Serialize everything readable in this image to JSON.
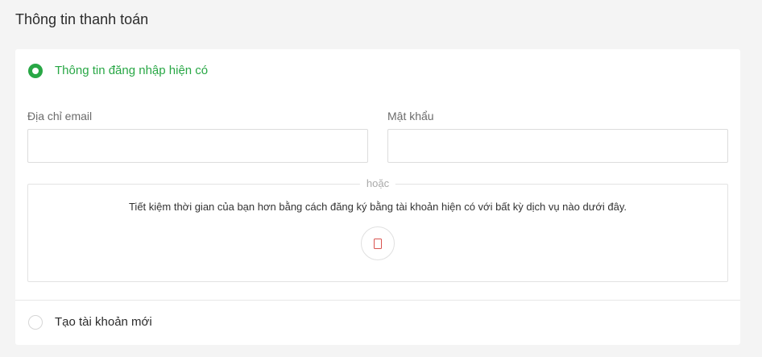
{
  "page": {
    "title": "Thông tin thanh toán"
  },
  "existing_login": {
    "label": "Thông tin đăng nhập hiện có",
    "selected": true,
    "email": {
      "label": "Địa chỉ email",
      "value": "",
      "placeholder": ""
    },
    "password": {
      "label": "Mật khẩu",
      "value": "",
      "placeholder": ""
    },
    "social": {
      "or_label": "hoặc",
      "description": "Tiết kiệm thời gian của bạn hơn bằng cách đăng ký bằng tài khoản hiện có với bất kỳ dịch vụ nào dưới đây.",
      "button_icon": "social-login-icon"
    }
  },
  "create_account": {
    "label": "Tạo tài khoản mới",
    "selected": false
  },
  "colors": {
    "accent": "#28a745",
    "social_icon": "#d9534f"
  }
}
